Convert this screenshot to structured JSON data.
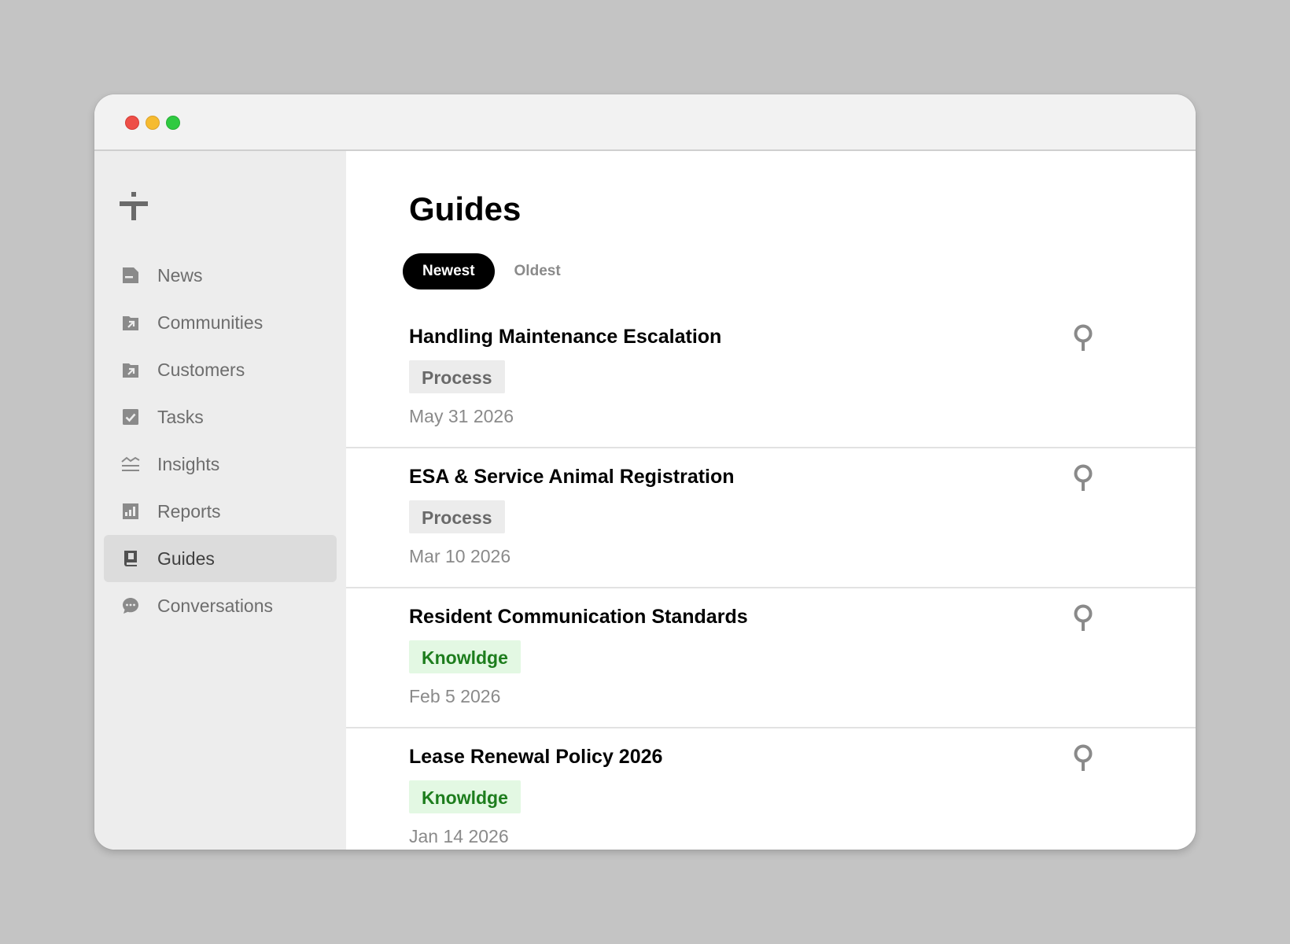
{
  "app": {
    "logo": "app-logo-icon"
  },
  "sidebar": {
    "items": [
      {
        "label": "News",
        "icon": "news-icon"
      },
      {
        "label": "Communities",
        "icon": "communities-icon"
      },
      {
        "label": "Customers",
        "icon": "customers-icon"
      },
      {
        "label": "Tasks",
        "icon": "tasks-icon"
      },
      {
        "label": "Insights",
        "icon": "insights-icon"
      },
      {
        "label": "Reports",
        "icon": "reports-icon"
      },
      {
        "label": "Guides",
        "icon": "guides-icon",
        "active": true
      },
      {
        "label": "Conversations",
        "icon": "conversations-icon"
      }
    ]
  },
  "main": {
    "title": "Guides",
    "sort": {
      "options": [
        "Newest",
        "Oldest"
      ],
      "selected": "Newest"
    },
    "guides": [
      {
        "title": "Handling Maintenance Escalation",
        "tag": "Process",
        "date": "May 31 2026"
      },
      {
        "title": "ESA & Service Animal Registration",
        "tag": "Process",
        "date": "Mar 10 2026"
      },
      {
        "title": "Resident Communication Standards",
        "tag": "Knowldge",
        "date": "Feb 5 2026"
      },
      {
        "title": "Lease Renewal Policy 2026",
        "tag": "Knowldge",
        "date": "Jan 14 2026"
      }
    ]
  },
  "colors": {
    "background": "#c4c4c4",
    "sidebar": "#ededed",
    "sidebar_active": "#dcdcdc",
    "tab_active": "#000000",
    "tag_process_bg": "#ececec",
    "tag_knowledge_bg": "#e3f8e3",
    "tag_knowledge_text": "#1d7d1d"
  }
}
